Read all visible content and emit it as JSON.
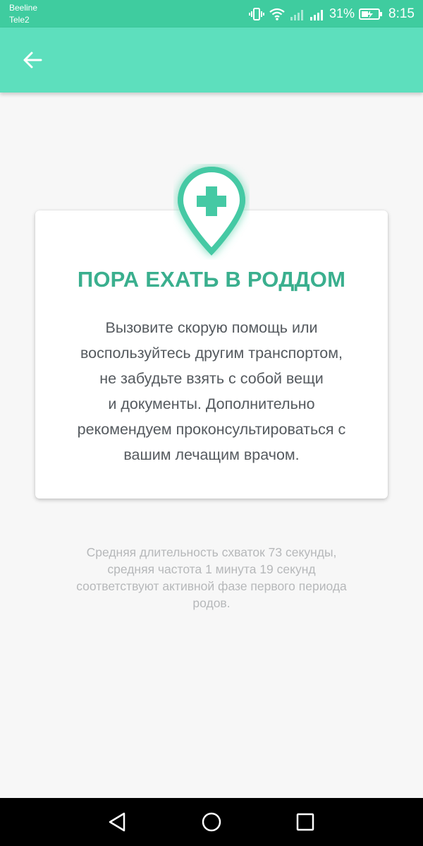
{
  "status_bar": {
    "carrier1": "Beeline",
    "carrier2": "Tele2",
    "battery_percent": "31%",
    "time": "8:15",
    "icons": [
      "vibrate-icon",
      "wifi-icon",
      "signal-icon",
      "signal-icon",
      "battery-icon"
    ]
  },
  "app_bar": {
    "back_icon": "arrow-left-icon",
    "color": "#5ddfbd"
  },
  "card": {
    "icon": "map-pin-cross-icon",
    "title": "ПОРА ЕХАТЬ В РОДДОМ",
    "text_lines": [
      "Вызовите скорую помощь или",
      "воспользуйтесь другим транспортом,",
      "не забудьте взять с собой вещи",
      "и документы. Дополнительно",
      "рекомендуем проконсультироваться с",
      "вашим лечащим врачом."
    ],
    "accent_color": "#3aaf8e"
  },
  "info": {
    "lines": [
      "Средняя длительность схваток 73 секунды,",
      "средняя частота 1 минута 19 секунд",
      "соответствуют активной фазе первого периода",
      "родов."
    ]
  },
  "nav_bar": {
    "icons": [
      "nav-back-icon",
      "nav-home-icon",
      "nav-recents-icon"
    ]
  }
}
